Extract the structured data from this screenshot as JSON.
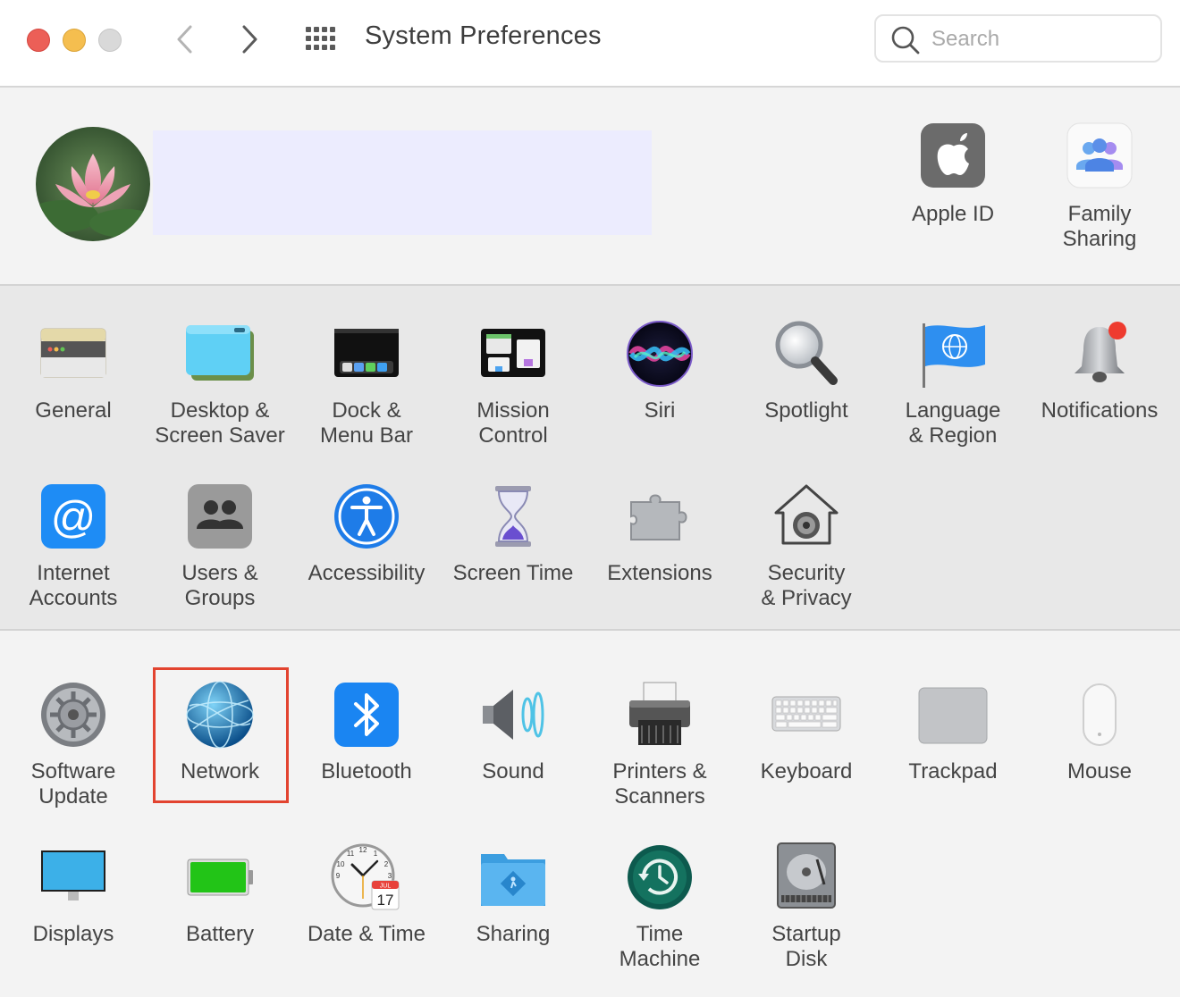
{
  "window": {
    "title": "System Preferences"
  },
  "search": {
    "placeholder": "Search"
  },
  "account_items": [
    {
      "label": "Apple ID"
    },
    {
      "label": "Family\nSharing"
    }
  ],
  "section1": [
    {
      "label": "General",
      "icon": "general-icon"
    },
    {
      "label": "Desktop &\nScreen Saver",
      "icon": "desktop-icon"
    },
    {
      "label": "Dock &\nMenu Bar",
      "icon": "dock-icon"
    },
    {
      "label": "Mission\nControl",
      "icon": "mission-control-icon"
    },
    {
      "label": "Siri",
      "icon": "siri-icon"
    },
    {
      "label": "Spotlight",
      "icon": "spotlight-icon"
    },
    {
      "label": "Language\n& Region",
      "icon": "language-icon"
    },
    {
      "label": "Notifications",
      "icon": "notifications-icon"
    },
    {
      "label": "Internet\nAccounts",
      "icon": "internet-accounts-icon"
    },
    {
      "label": "Users &\nGroups",
      "icon": "users-icon"
    },
    {
      "label": "Accessibility",
      "icon": "accessibility-icon"
    },
    {
      "label": "Screen Time",
      "icon": "screen-time-icon"
    },
    {
      "label": "Extensions",
      "icon": "extensions-icon"
    },
    {
      "label": "Security\n& Privacy",
      "icon": "security-icon"
    }
  ],
  "section2": [
    {
      "label": "Software\nUpdate",
      "icon": "software-update-icon"
    },
    {
      "label": "Network",
      "icon": "network-icon"
    },
    {
      "label": "Bluetooth",
      "icon": "bluetooth-icon"
    },
    {
      "label": "Sound",
      "icon": "sound-icon"
    },
    {
      "label": "Printers &\nScanners",
      "icon": "printer-icon"
    },
    {
      "label": "Keyboard",
      "icon": "keyboard-icon"
    },
    {
      "label": "Trackpad",
      "icon": "trackpad-icon"
    },
    {
      "label": "Mouse",
      "icon": "mouse-icon"
    },
    {
      "label": "Displays",
      "icon": "displays-icon"
    },
    {
      "label": "Battery",
      "icon": "battery-icon"
    },
    {
      "label": "Date & Time",
      "icon": "date-time-icon"
    },
    {
      "label": "Sharing",
      "icon": "sharing-icon"
    },
    {
      "label": "Time\nMachine",
      "icon": "time-machine-icon"
    },
    {
      "label": "Startup\nDisk",
      "icon": "startup-disk-icon"
    }
  ],
  "clock_badge": {
    "month": "JUL",
    "day": "17"
  },
  "highlight": {
    "target": "Network",
    "color": "#e2432f"
  }
}
